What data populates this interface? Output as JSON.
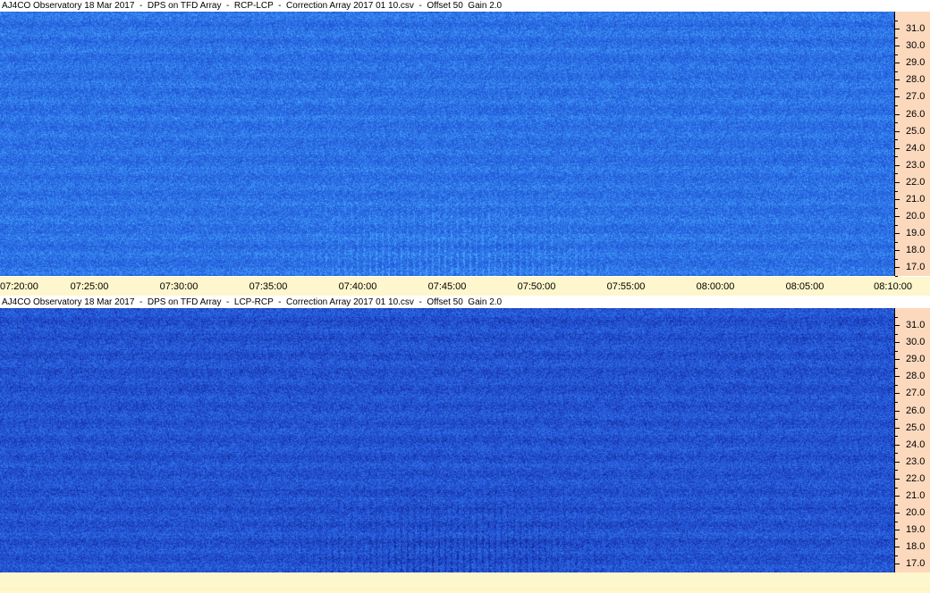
{
  "panels": [
    {
      "title": "AJ4CO Observatory 18 Mar 2017  -  DPS on TFD Array  -  RCP-LCP  -  Correction Array 2017 01 10.csv  -  Offset 50  Gain 2.0",
      "polarization": "RCP-LCP",
      "base_color": "#2a6ee8",
      "highlight_color": "#4fb8ff",
      "dark_color": "#1a40c0",
      "burst_style": "bright"
    },
    {
      "title": "AJ4CO Observatory 18 Mar 2017  -  DPS on TFD Array  -  LCP-RCP  -  Correction Array 2017 01 10.csv  -  Offset 50  Gain 2.0",
      "polarization": "LCP-RCP",
      "base_color": "#2452d8",
      "highlight_color": "#3a8ef0",
      "dark_color": "#0c1f88",
      "burst_style": "dark"
    }
  ],
  "frequency_axis": {
    "unit": "MHz",
    "min": 16.5,
    "max": 32.0,
    "labels": [
      "31.0",
      "30.0",
      "29.0",
      "28.0",
      "27.0",
      "26.0",
      "25.0",
      "24.0",
      "23.0",
      "22.0",
      "21.0",
      "20.0",
      "19.0",
      "18.0",
      "17.0"
    ],
    "values": [
      31,
      30,
      29,
      28,
      27,
      26,
      25,
      24,
      23,
      22,
      21,
      20,
      19,
      18,
      17
    ]
  },
  "time_axis": {
    "start": "07:20:00",
    "end": "08:10:00",
    "labels": [
      "07:20:00",
      "07:25:00",
      "07:30:00",
      "07:35:00",
      "07:40:00",
      "07:45:00",
      "07:50:00",
      "07:55:00",
      "08:00:00",
      "08:05:00",
      "08:10:00"
    ],
    "minutes": [
      0,
      5,
      10,
      15,
      20,
      25,
      30,
      35,
      40,
      45,
      50
    ]
  },
  "colors": {
    "freq_axis_bg": "#fcd9bd",
    "time_axis_bg": "#fef6cc"
  }
}
